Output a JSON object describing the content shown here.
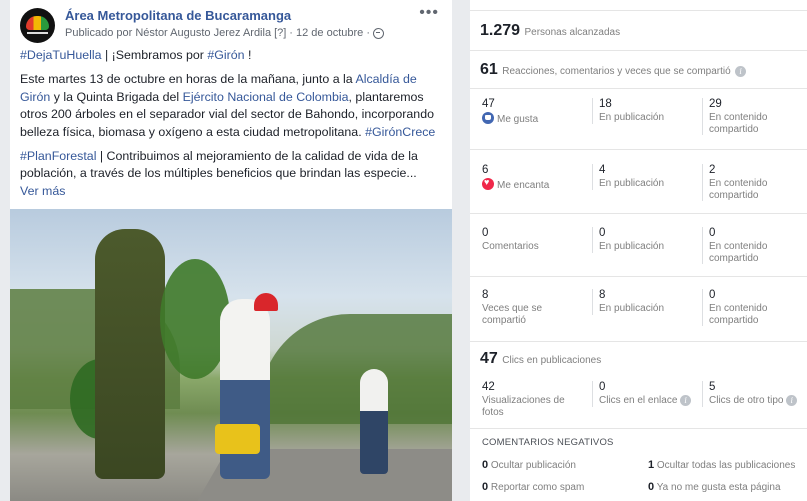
{
  "post": {
    "page_name": "Área Metropolitana de Bucaramanga",
    "byline_prefix": "Publicado por Néstor Augusto Jerez Ardila",
    "byline_tag": "[?]",
    "byline_date": "· 12 de octubre ·",
    "p1_hashtag1": "#DejaTuHuella",
    "p1_sep": " | ¡Sembramos por ",
    "p1_hashtag2": "#Girón",
    "p1_end": " !",
    "p2_a": "Este martes 13 de octubre en horas de la mañana, junto a la ",
    "p2_link1": "Alcaldía de Girón",
    "p2_b": " y la Quinta Brigada del ",
    "p2_link2": "Ejército Nacional de Colombia",
    "p2_c": ", plantaremos otros 200 árboles en el separador vial del sector de Bahondo, incorporando belleza física, biomasa y oxígeno a esta ciudad metropolitana. ",
    "p2_hashtag": "#GirónCrece",
    "p3_hashtag": "#PlanForestal",
    "p3_text": " | Contribuimos al mejoramiento de la calidad de vida de la población, a través de los múltiples beneficios que brindan las especie...",
    "see_more": "Ver más"
  },
  "insights": {
    "reach_num": "1.279",
    "reach_label": "Personas alcanzadas",
    "engage_num": "61",
    "engage_label": "Reacciones, comentarios y veces que se compartió",
    "rows": [
      {
        "c1_num": "47",
        "c1_lbl": "Me gusta",
        "c2_num": "18",
        "c2_lbl": "En publicación",
        "c3_num": "29",
        "c3_lbl": "En contenido compartido"
      },
      {
        "c1_num": "6",
        "c1_lbl": "Me encanta",
        "c2_num": "4",
        "c2_lbl": "En publicación",
        "c3_num": "2",
        "c3_lbl": "En contenido compartido"
      },
      {
        "c1_num": "0",
        "c1_lbl": "Comentarios",
        "c2_num": "0",
        "c2_lbl": "En publicación",
        "c3_num": "0",
        "c3_lbl": "En contenido compartido"
      },
      {
        "c1_num": "8",
        "c1_lbl": "Veces que se compartió",
        "c2_num": "8",
        "c2_lbl": "En publicación",
        "c3_num": "0",
        "c3_lbl": "En contenido compartido"
      }
    ],
    "clicks_num": "47",
    "clicks_label": "Clics en publicaciones",
    "clicks": {
      "c1_num": "42",
      "c1_lbl": "Visualizaciones de fotos",
      "c2_num": "0",
      "c2_lbl": "Clics en el enlace",
      "c3_num": "5",
      "c3_lbl": "Clics de otro tipo"
    },
    "negative_title": "COMENTARIOS NEGATIVOS",
    "neg": [
      {
        "num": "0",
        "label": "Ocultar publicación"
      },
      {
        "num": "1",
        "label": "Ocultar todas las publicaciones"
      },
      {
        "num": "0",
        "label": "Reportar como spam"
      },
      {
        "num": "0",
        "label": "Ya no me gusta esta página"
      }
    ]
  },
  "icons": {
    "like": "like-icon",
    "love": "love-icon",
    "info": "info-icon",
    "globe": "globe-icon",
    "more": "more-icon"
  },
  "colors": {
    "link": "#365899",
    "like": "#4267b2",
    "love": "#f0284a"
  }
}
